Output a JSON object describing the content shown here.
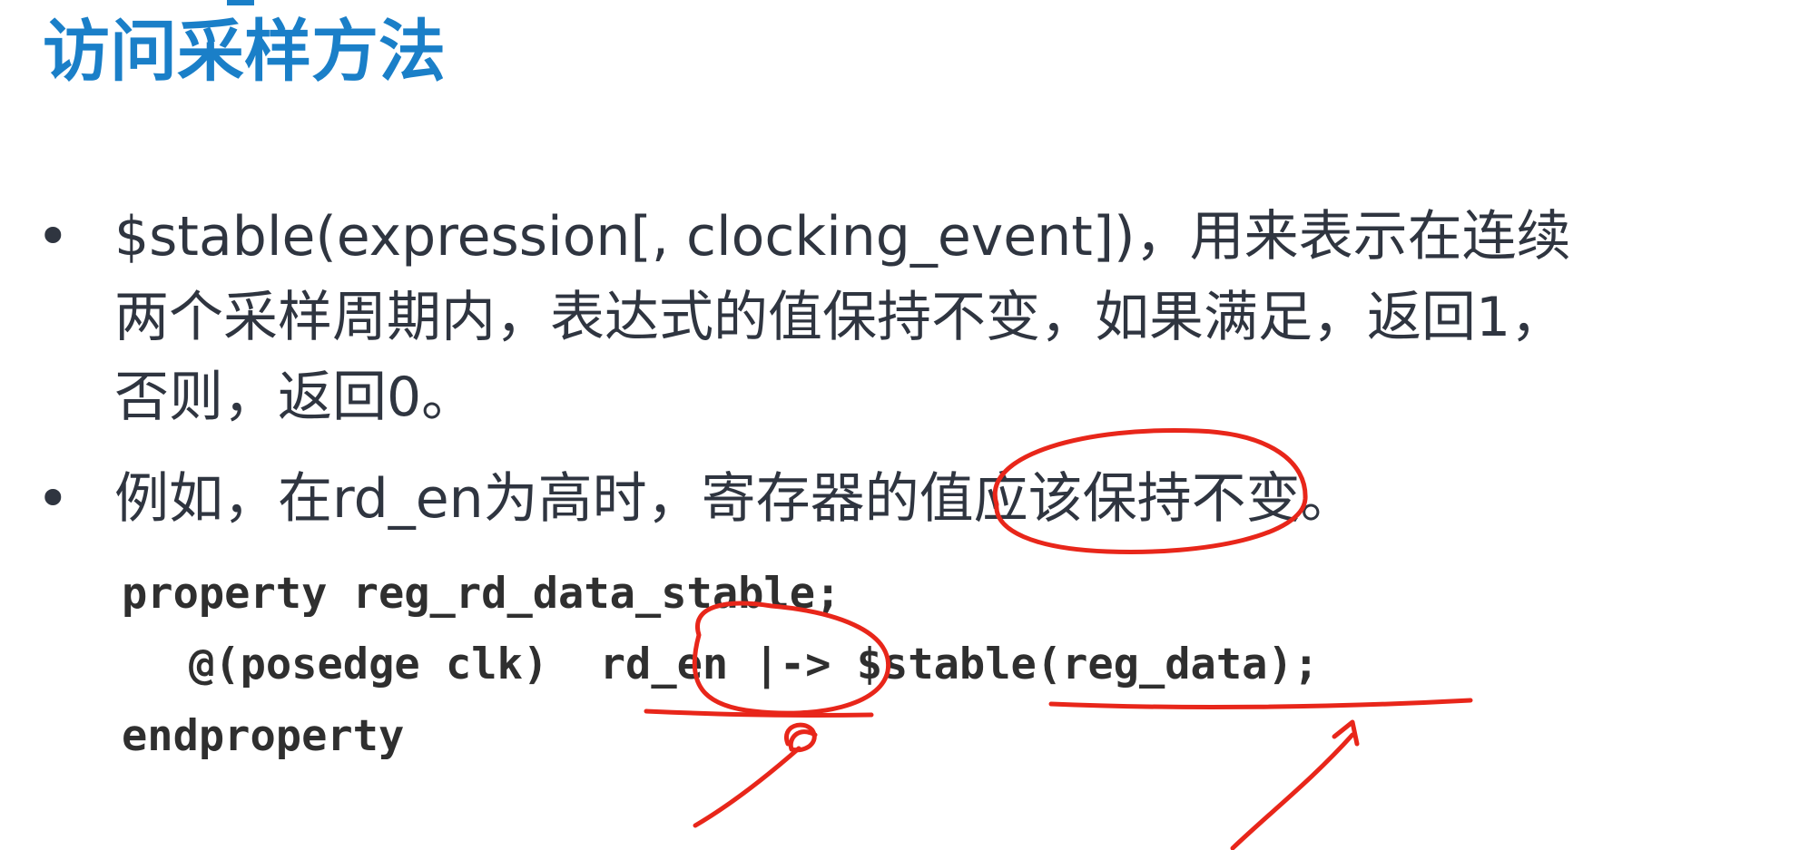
{
  "slide": {
    "title": "访问采样方法",
    "bullet_symbol": "•",
    "bullets": [
      {
        "lines": [
          "$stable(expression[, clocking_event])，用来表示在连续",
          "两个采样周期内，表达式的值保持不变，如果满足，返回1，",
          "否则，返回0。"
        ]
      },
      {
        "lines": [
          "例如，在rd_en为高时，寄存器的值应该保持不变。"
        ]
      }
    ],
    "code_lines": [
      "property reg_rd_data_stable;",
      "@(posedge clk)  rd_en |-> $stable(reg_data);",
      "endproperty"
    ]
  },
  "colors": {
    "title": "#1a7fc8",
    "body_text": "#2f3540",
    "code_text": "#2f2f2f",
    "annotation": "#e8261a"
  }
}
